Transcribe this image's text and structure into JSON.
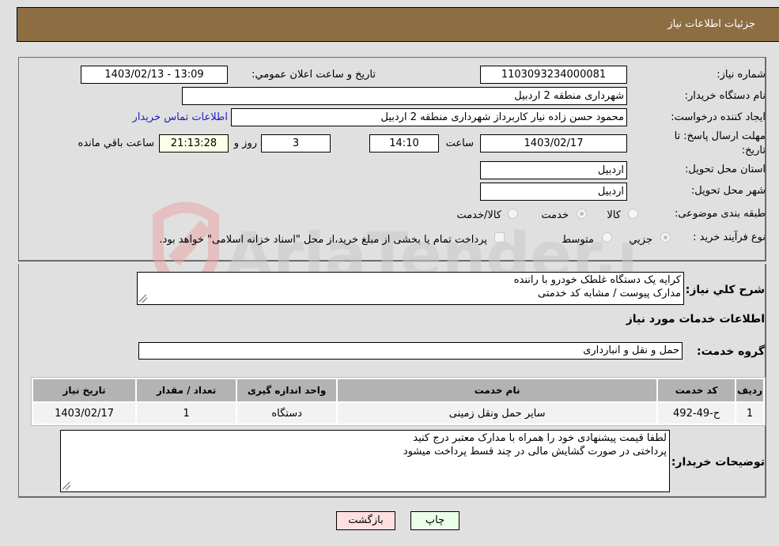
{
  "header": {
    "title": "جزئیات اطلاعات نیاز"
  },
  "fields": {
    "need_number_label": "شماره نیاز:",
    "need_number": "1103093234000081",
    "announce_label": "تاريخ و ساعت اعلان عمومي:",
    "announce_value": "1403/02/13 - 13:09",
    "buyer_label": "نام دستگاه خريدار:",
    "buyer_value": "شهرداری منطقه 2 اردبیل",
    "creator_label": "ايجاد کننده درخواست:",
    "creator_value": "محمود حسن زاده نیار کاربرداز شهرداری منطقه 2 اردبیل",
    "contact_link": "اطلاعات تماس خريدار",
    "deadline_label": "مهلت ارسال پاسخ: تا تاریخ:",
    "deadline_date": "1403/02/17",
    "time_label": "ساعت",
    "deadline_time": "14:10",
    "days_value": "3",
    "days_label": "روز و",
    "remaining_value": "21:13:28",
    "remaining_label": "ساعت باقي مانده",
    "province_label": "استان محل تحويل:",
    "province_value": "اردبیل",
    "city_label": "شهر محل تحويل:",
    "city_value": "اردبیل",
    "category_label": "طبقه بندی موضوعی:",
    "category_options": [
      "کالا",
      "خدمت",
      "کالا/خدمت"
    ],
    "category_selected": "خدمت",
    "process_label": "نوع فرآيند خريد :",
    "process_options": [
      "جزيي",
      "متوسط"
    ],
    "process_selected": "جزيي",
    "treasury_note": "پرداخت تمام يا بخشی از مبلغ خريد،از محل \"اسناد خزانه اسلامی\" خواهد بود."
  },
  "description": {
    "label": "شرح کلي نياز:",
    "lines": [
      "کرايه يک دستگاه غلطک خودرو با راننده",
      "مدارک پيوست / مشابه کد خدمتی"
    ]
  },
  "services_section": {
    "title": "اطلاعات خدمات مورد نياز",
    "group_label": "گروه خدمت:",
    "group_value": "حمل و نقل و انبارداری"
  },
  "table": {
    "headers": [
      "رديف",
      "کد خدمت",
      "نام خدمت",
      "واحد اندازه گيری",
      "تعداد / مقدار",
      "تاريخ نياز"
    ],
    "rows": [
      [
        "1",
        "ح-49-492",
        "ساير حمل ونقل زمينی",
        "دستگاه",
        "1",
        "1403/02/17"
      ]
    ]
  },
  "buyer_notes": {
    "label": "توضيحات خريدار:",
    "lines": [
      "لطفا قيمت پيشنهادی خود را همراه با مدارک معتبر درج کنيد",
      "پرداختی در صورت گشايش مالی در چند قسط پرداخت ميشود"
    ]
  },
  "buttons": {
    "print": "چاپ",
    "back": "بازگشت"
  },
  "watermark": {
    "text": "AriaTender.neT"
  },
  "colors": {
    "header_bg": "#8d6e43",
    "back_btn_bg": "#ffe0e0",
    "print_btn_bg": "#eaffea",
    "link": "#1a1acc"
  }
}
